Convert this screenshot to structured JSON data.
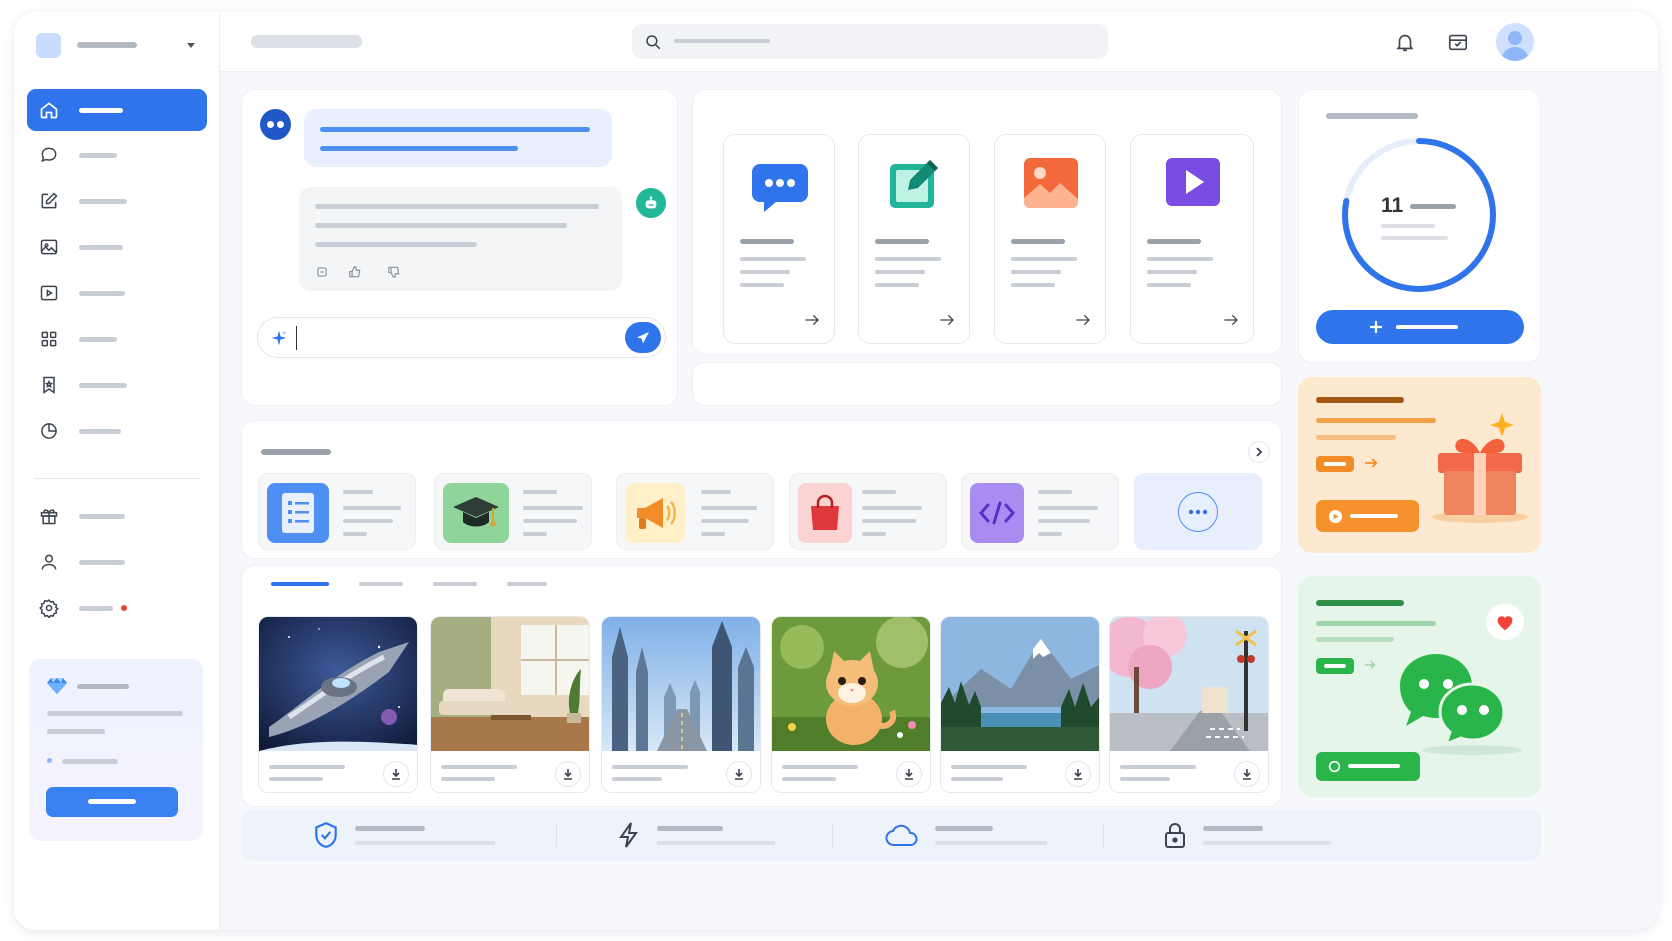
{
  "app": {
    "name": ""
  },
  "sidebar": {
    "items": [
      {
        "icon": "home-icon",
        "active": true
      },
      {
        "icon": "chat-bubble-icon"
      },
      {
        "icon": "edit-icon"
      },
      {
        "icon": "image-icon"
      },
      {
        "icon": "play-icon"
      },
      {
        "icon": "grid-icon"
      },
      {
        "icon": "bookmark-icon"
      },
      {
        "icon": "history-icon"
      }
    ],
    "secondary": [
      {
        "icon": "gift-icon"
      },
      {
        "icon": "user-icon"
      },
      {
        "icon": "settings-icon",
        "badge": true
      }
    ],
    "promo": {
      "icon": "diamond-icon"
    }
  },
  "header": {
    "search_placeholder": "",
    "icons": [
      "bell-icon",
      "wallet-icon",
      "avatar"
    ]
  },
  "chat": {
    "input_value": "",
    "input_icon": "sparkle-icon",
    "send_icon": "send-icon",
    "tools": [
      "globe-icon",
      "attach-icon",
      "magic-wand-icon",
      "save-icon",
      "sliders-icon"
    ],
    "reply_actions": [
      "copy-icon",
      "thumbs-up-icon",
      "thumbs-down-icon"
    ]
  },
  "apps": [
    {
      "icon": "chat-app-icon",
      "color": "#2f74ea"
    },
    {
      "icon": "edit-app-icon",
      "color": "#22b59a"
    },
    {
      "icon": "image-app-icon",
      "color": "#f26a3c"
    },
    {
      "icon": "video-app-icon",
      "color": "#7a4ce3"
    }
  ],
  "credits": {
    "value": "11",
    "progress": 0.78,
    "ring_color": "#2f74ea",
    "accent_color": "#21c1a0"
  },
  "tools": [
    {
      "icon": "document-icon",
      "color": "#4d8ff2"
    },
    {
      "icon": "graduation-cap-icon",
      "color": "#7fcf8f"
    },
    {
      "icon": "megaphone-icon",
      "color": "#ffc94a"
    },
    {
      "icon": "shopping-bag-icon",
      "color": "#f06b6b"
    },
    {
      "icon": "code-icon",
      "color": "#9a7cf0"
    },
    {
      "icon": "more-icon",
      "color": "#e7efff"
    }
  ],
  "gallery": {
    "active_tab": 0,
    "images": [
      {
        "subject": "spaceship"
      },
      {
        "subject": "living-room"
      },
      {
        "subject": "futuristic-city"
      },
      {
        "subject": "kitten"
      },
      {
        "subject": "mountain-lake"
      },
      {
        "subject": "cherry-blossom-street"
      }
    ]
  },
  "promos": {
    "gift": {
      "bg": "#fde9cf",
      "accent": "#f28c28"
    },
    "wechat": {
      "bg": "#e6f5e9",
      "accent": "#2ab54a"
    }
  },
  "features": [
    "shield-check-icon",
    "lightning-icon",
    "cloud-icon",
    "lock-icon"
  ]
}
